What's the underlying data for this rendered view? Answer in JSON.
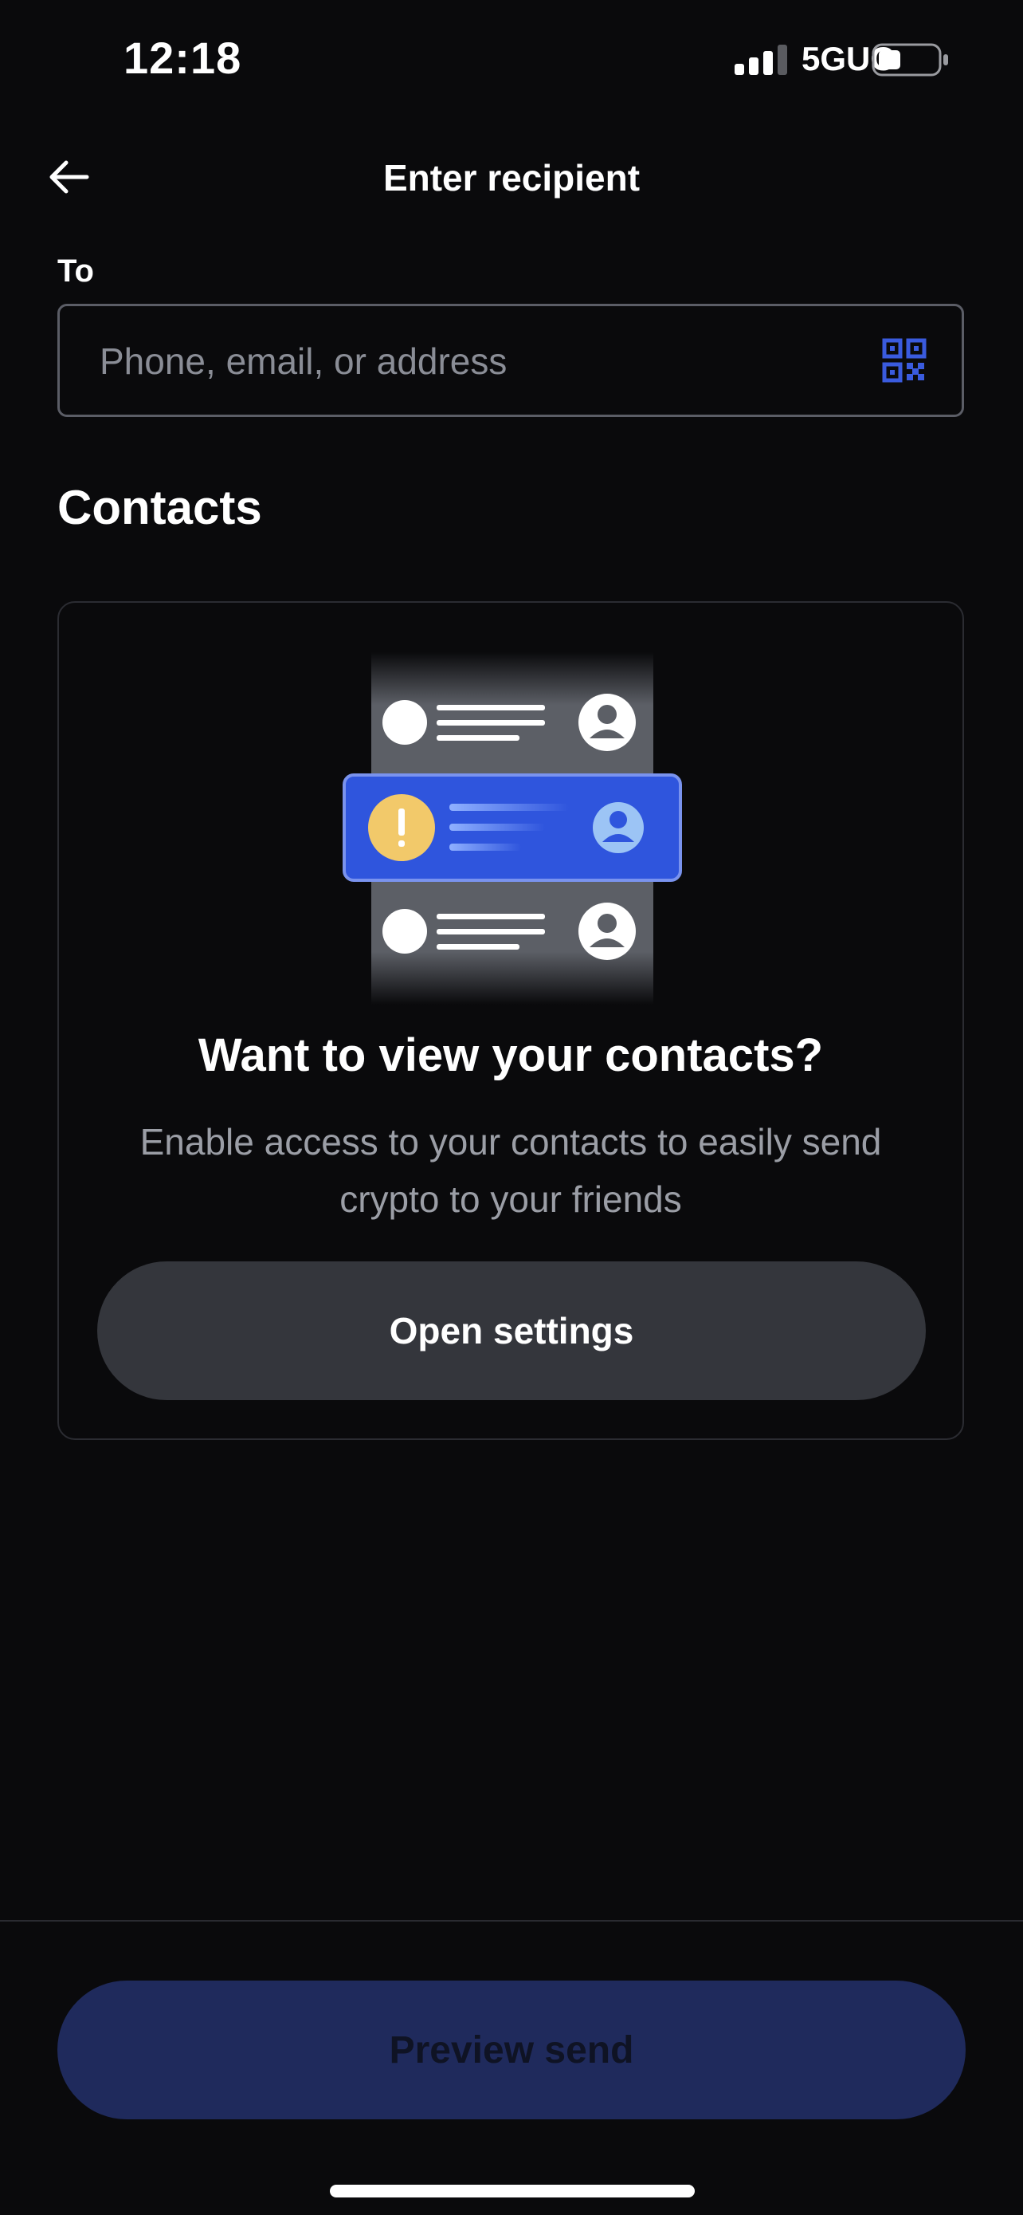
{
  "status_bar": {
    "time": "12:18",
    "network": "5GUC",
    "icons": [
      "cellular-signal-icon",
      "battery-icon"
    ]
  },
  "header": {
    "title": "Enter recipient",
    "back_icon": "back-arrow-icon"
  },
  "recipient": {
    "label": "To",
    "placeholder": "Phone, email, or address",
    "value": "",
    "scan_icon": "qr-code-icon"
  },
  "contacts": {
    "heading": "Contacts",
    "card": {
      "illustration_icon": "contacts-list-illustration",
      "title": "Want to view your contacts?",
      "description": "Enable access to your contacts to easily send crypto to your friends",
      "button_label": "Open settings"
    }
  },
  "footer": {
    "primary_button_label": "Preview send",
    "primary_button_enabled": false
  },
  "colors": {
    "background": "#0a0a0c",
    "accent": "#3a5bde",
    "disabled_button": "#1f2a5c",
    "secondary_button": "#34363c",
    "warning": "#f2c96a"
  }
}
